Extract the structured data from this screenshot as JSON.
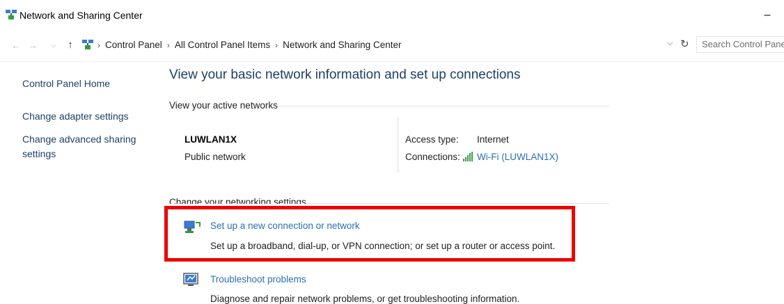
{
  "window": {
    "title": "Network and Sharing Center",
    "minimize": "–"
  },
  "nav": {
    "back": "←",
    "forward": "→",
    "recent": "⌵",
    "up": "↑",
    "dropdown": "⌵",
    "refresh": "↻"
  },
  "breadcrumb": [
    "Control Panel",
    "All Control Panel Items",
    "Network and Sharing Center"
  ],
  "breadcrumb_sep": "›",
  "search": {
    "placeholder": "Search Control Panel"
  },
  "sidebar": {
    "items": [
      {
        "label": "Control Panel Home"
      },
      {
        "label": "Change adapter settings"
      },
      {
        "label": "Change advanced sharing settings"
      }
    ]
  },
  "main": {
    "title": "View your basic network information and set up connections",
    "active_networks_header": "View your active networks",
    "network": {
      "name": "LUWLAN1X",
      "type": "Public network",
      "access_label": "Access type:",
      "access_value": "Internet",
      "connections_label": "Connections:",
      "connection_link": "Wi-Fi (LUWLAN1X)"
    },
    "change_header": "Change your networking settings",
    "tasks": [
      {
        "title": "Set up a new connection or network",
        "desc": "Set up a broadband, dial-up, or VPN connection; or set up a router or access point."
      },
      {
        "title": "Troubleshoot problems",
        "desc": "Diagnose and repair network problems, or get troubleshooting information."
      }
    ]
  },
  "colors": {
    "link": "#2a6fb5",
    "heading": "#1e3f66",
    "highlight": "#ee0000"
  },
  "icons": [
    "network-sharing-icon",
    "wifi-signal-icon",
    "new-connection-icon",
    "troubleshoot-icon"
  ]
}
